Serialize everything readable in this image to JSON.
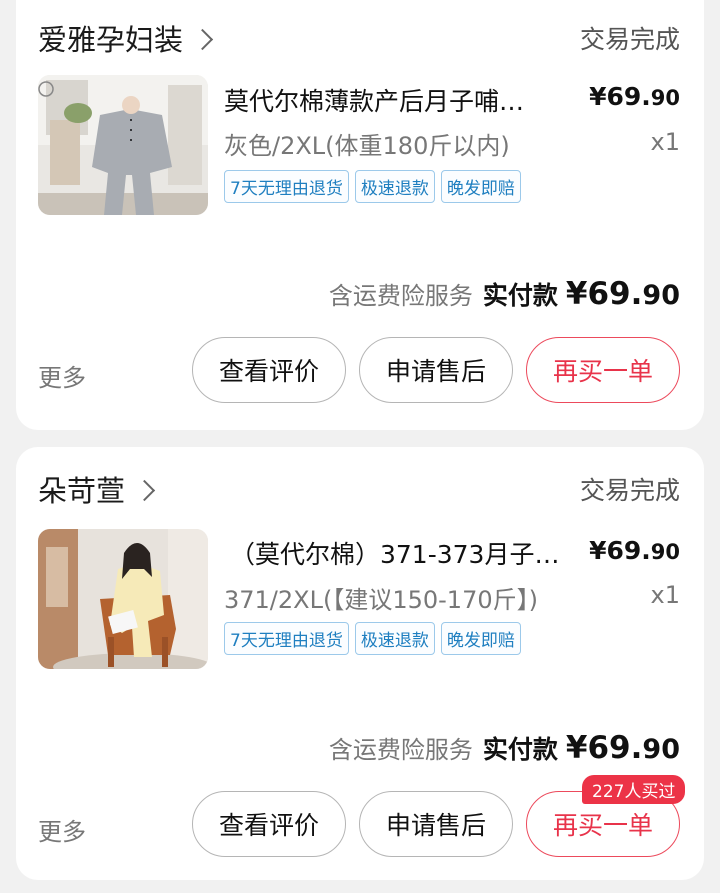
{
  "orders": [
    {
      "shop_name": "爱雅孕妇装",
      "status": "交易完成",
      "product_title": "莫代尔棉薄款产后月子哺…",
      "price_main": "¥69.",
      "price_decimal": "90",
      "variant": "灰色/2XL(体重180斤以内)",
      "quantity": "x1",
      "tags": [
        "7天无理由退货",
        "极速退款",
        "晚发即赔"
      ],
      "service_text": "含运费险服务",
      "paid_label": "实付款",
      "paid_main": "¥69.",
      "paid_decimal": "90",
      "more_label": "更多",
      "review_label": "查看评价",
      "aftersale_label": "申请售后",
      "rebuy_label": "再买一单"
    },
    {
      "shop_name": "朵苛萱",
      "status": "交易完成",
      "product_title": "（莫代尔棉）371-373月子…",
      "price_main": "¥69.",
      "price_decimal": "90",
      "variant": "371/2XL(【建议150-170斤】)",
      "quantity": "x1",
      "tags": [
        "7天无理由退货",
        "极速退款",
        "晚发即赔"
      ],
      "service_text": "含运费险服务",
      "paid_label": "实付款",
      "paid_main": "¥69.",
      "paid_decimal": "90",
      "more_label": "更多",
      "review_label": "查看评价",
      "aftersale_label": "申请售后",
      "rebuy_label": "再买一单",
      "rebuy_badge": "227人买过"
    }
  ],
  "colors": {
    "accent": "#e8334a",
    "tag": "#1f7fc0",
    "background": "#f1f1f1"
  }
}
